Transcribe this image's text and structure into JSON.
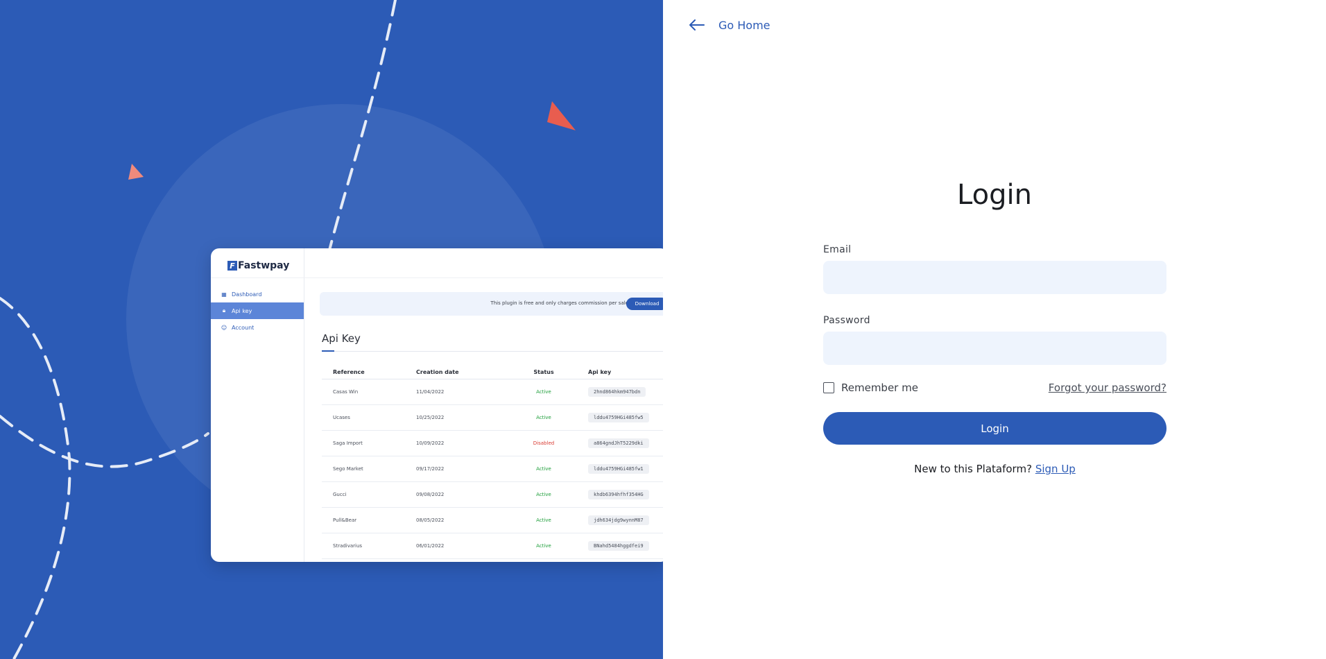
{
  "preview": {
    "logo": "Fastwpay",
    "logo_mark": "F",
    "nav": [
      {
        "label": "Dashboard",
        "icon": "dashboard-icon",
        "active": false
      },
      {
        "label": "Api key",
        "icon": "lock-icon",
        "active": true
      },
      {
        "label": "Account",
        "icon": "user-icon",
        "active": false
      }
    ],
    "banner_text": "This plugin is free and only charges commission per sale",
    "download_label": "Download",
    "section_title": "Api Key",
    "table": {
      "headers": [
        "Reference",
        "Creation date",
        "Status",
        "Api key"
      ],
      "rows": [
        {
          "reference": "Casas Win",
          "date": "11/04/2022",
          "status": "Active",
          "key": "2hnd864hkm947bdn"
        },
        {
          "reference": "Ucases",
          "date": "10/25/2022",
          "status": "Active",
          "key": "lddu4759HGi485fw5"
        },
        {
          "reference": "Saga Import",
          "date": "10/09/2022",
          "status": "Disabled",
          "key": "a864gndJhT5229dki"
        },
        {
          "reference": "Sego Market",
          "date": "09/17/2022",
          "status": "Active",
          "key": "lddu4759HGi485fw1"
        },
        {
          "reference": "Gucci",
          "date": "09/08/2022",
          "status": "Active",
          "key": "khdb6394hfhf354HG"
        },
        {
          "reference": "Pull&Bear",
          "date": "08/05/2022",
          "status": "Active",
          "key": "jdh634jdg9wynnM87"
        },
        {
          "reference": "Stradivarius",
          "date": "06/01/2022",
          "status": "Active",
          "key": "BNahd5484hggdfei9"
        }
      ]
    }
  },
  "nav": {
    "go_home": "Go Home"
  },
  "login": {
    "title": "Login",
    "email_label": "Email",
    "email_value": "",
    "email_placeholder": "",
    "password_label": "Password",
    "password_value": "",
    "password_placeholder": "",
    "remember_label": "Remember me",
    "remember_checked": false,
    "forgot_label": "Forgot your password?",
    "submit_label": "Login",
    "signup_prompt": "New to this Plataform?",
    "signup_link": "Sign Up"
  },
  "colors": {
    "brand_blue": "#2c5bb6",
    "input_bg": "#eef4fd",
    "accent_coral": "#e85d4f",
    "status_active": "#1e9e3a",
    "status_disabled": "#d93a32"
  }
}
